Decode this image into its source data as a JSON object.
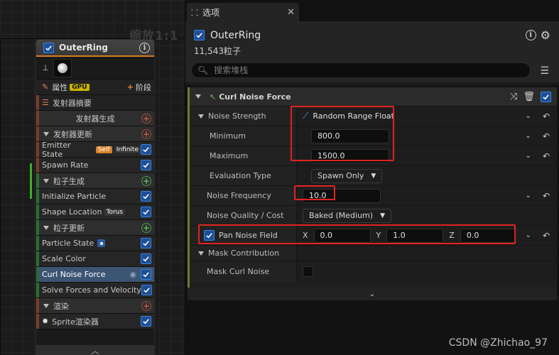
{
  "graph": {
    "zoom_label": "缩放1:1"
  },
  "emitter_node": {
    "title": "OuterRing",
    "enabled": true,
    "properties_label": "属性",
    "gpu_tag": "GPU",
    "stage_button": "阶段",
    "summary_label": "发射器摘要",
    "rows": [
      {
        "label": "发射器生成",
        "kind": "section-sub",
        "add_color": "red"
      },
      {
        "label": "发射器更新",
        "kind": "section",
        "add_color": "red"
      },
      {
        "label": "Emitter State",
        "kind": "item",
        "tags": [
          "Self",
          "Infinite"
        ],
        "checked": true
      },
      {
        "label": "Spawn Rate",
        "kind": "item",
        "checked": true
      },
      {
        "label": "粒子生成",
        "kind": "section",
        "add_color": "green"
      },
      {
        "label": "Initialize Particle",
        "kind": "item",
        "checked": true
      },
      {
        "label": "Shape Location",
        "kind": "item",
        "tags": [
          "Torus"
        ],
        "checked": true
      },
      {
        "label": "粒子更新",
        "kind": "section",
        "add_color": "green"
      },
      {
        "label": "Particle State",
        "kind": "item",
        "checked": true
      },
      {
        "label": "Scale Color",
        "kind": "item",
        "checked": true
      },
      {
        "label": "Curl Noise Force",
        "kind": "item",
        "selected": true,
        "checked": true
      },
      {
        "label": "Solve Forces and Velocity",
        "kind": "item",
        "checked": true
      },
      {
        "label": "渲染",
        "kind": "section",
        "add_color": "red"
      },
      {
        "label": "Sprite渲染器",
        "kind": "item",
        "checked": true
      }
    ]
  },
  "panel": {
    "tab_label": "选项",
    "title": "OuterRing",
    "particle_count": "11,543粒子",
    "search_placeholder": "搜索堆栈",
    "category": "Curl Noise Force",
    "noise_strength": {
      "label": "Noise Strength",
      "mode": "Random Range Float",
      "minimum_label": "Minimum",
      "minimum": "800.0",
      "maximum_label": "Maximum",
      "maximum": "1500.0",
      "evaluation_label": "Evaluation Type",
      "evaluation": "Spawn Only"
    },
    "noise_frequency": {
      "label": "Noise Frequency",
      "value": "10.0"
    },
    "noise_quality": {
      "label": "Noise Quality / Cost",
      "value": "Baked (Medium)"
    },
    "pan_noise_field": {
      "label": "Pan Noise Field",
      "enabled": true,
      "x_label": "X",
      "x": "0.0",
      "y_label": "Y",
      "y": "1.0",
      "z_label": "Z",
      "z": "0.0"
    },
    "mask_contribution": {
      "label": "Mask Contribution"
    },
    "mask_curl_noise": {
      "label": "Mask Curl Noise",
      "enabled": false
    }
  },
  "watermark": "CSDN @Zhichao_97",
  "colors": {
    "highlight_box": "#e0231d",
    "checkbox": "#1e4f95",
    "selected_row": "#3d5574",
    "node_header_accent": "#dd7a20"
  }
}
